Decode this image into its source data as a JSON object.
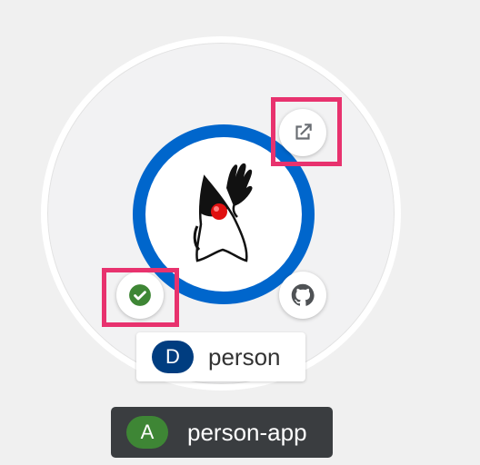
{
  "node": {
    "name": "person",
    "type_badge": "D",
    "type_badge_color": "#003d80",
    "ring_color": "#0066cc",
    "icon": "java-duke-icon",
    "status": "success",
    "status_color": "#3e8635"
  },
  "decorators": {
    "external_link": "external-link-icon",
    "status": "check-circle-icon",
    "source": "github-icon"
  },
  "application": {
    "name": "person-app",
    "badge": "A",
    "badge_color": "#3e8635"
  },
  "highlight_color": "#e8326e"
}
